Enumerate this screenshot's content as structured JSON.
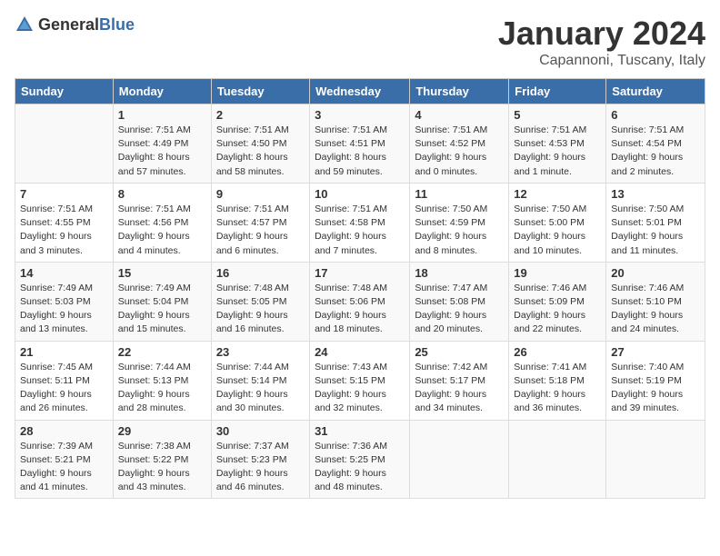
{
  "header": {
    "logo_general": "General",
    "logo_blue": "Blue",
    "month_title": "January 2024",
    "location": "Capannoni, Tuscany, Italy"
  },
  "weekdays": [
    "Sunday",
    "Monday",
    "Tuesday",
    "Wednesday",
    "Thursday",
    "Friday",
    "Saturday"
  ],
  "weeks": [
    [
      {
        "day": "",
        "info": ""
      },
      {
        "day": "1",
        "info": "Sunrise: 7:51 AM\nSunset: 4:49 PM\nDaylight: 8 hours\nand 57 minutes."
      },
      {
        "day": "2",
        "info": "Sunrise: 7:51 AM\nSunset: 4:50 PM\nDaylight: 8 hours\nand 58 minutes."
      },
      {
        "day": "3",
        "info": "Sunrise: 7:51 AM\nSunset: 4:51 PM\nDaylight: 8 hours\nand 59 minutes."
      },
      {
        "day": "4",
        "info": "Sunrise: 7:51 AM\nSunset: 4:52 PM\nDaylight: 9 hours\nand 0 minutes."
      },
      {
        "day": "5",
        "info": "Sunrise: 7:51 AM\nSunset: 4:53 PM\nDaylight: 9 hours\nand 1 minute."
      },
      {
        "day": "6",
        "info": "Sunrise: 7:51 AM\nSunset: 4:54 PM\nDaylight: 9 hours\nand 2 minutes."
      }
    ],
    [
      {
        "day": "7",
        "info": "Sunrise: 7:51 AM\nSunset: 4:55 PM\nDaylight: 9 hours\nand 3 minutes."
      },
      {
        "day": "8",
        "info": "Sunrise: 7:51 AM\nSunset: 4:56 PM\nDaylight: 9 hours\nand 4 minutes."
      },
      {
        "day": "9",
        "info": "Sunrise: 7:51 AM\nSunset: 4:57 PM\nDaylight: 9 hours\nand 6 minutes."
      },
      {
        "day": "10",
        "info": "Sunrise: 7:51 AM\nSunset: 4:58 PM\nDaylight: 9 hours\nand 7 minutes."
      },
      {
        "day": "11",
        "info": "Sunrise: 7:50 AM\nSunset: 4:59 PM\nDaylight: 9 hours\nand 8 minutes."
      },
      {
        "day": "12",
        "info": "Sunrise: 7:50 AM\nSunset: 5:00 PM\nDaylight: 9 hours\nand 10 minutes."
      },
      {
        "day": "13",
        "info": "Sunrise: 7:50 AM\nSunset: 5:01 PM\nDaylight: 9 hours\nand 11 minutes."
      }
    ],
    [
      {
        "day": "14",
        "info": "Sunrise: 7:49 AM\nSunset: 5:03 PM\nDaylight: 9 hours\nand 13 minutes."
      },
      {
        "day": "15",
        "info": "Sunrise: 7:49 AM\nSunset: 5:04 PM\nDaylight: 9 hours\nand 15 minutes."
      },
      {
        "day": "16",
        "info": "Sunrise: 7:48 AM\nSunset: 5:05 PM\nDaylight: 9 hours\nand 16 minutes."
      },
      {
        "day": "17",
        "info": "Sunrise: 7:48 AM\nSunset: 5:06 PM\nDaylight: 9 hours\nand 18 minutes."
      },
      {
        "day": "18",
        "info": "Sunrise: 7:47 AM\nSunset: 5:08 PM\nDaylight: 9 hours\nand 20 minutes."
      },
      {
        "day": "19",
        "info": "Sunrise: 7:46 AM\nSunset: 5:09 PM\nDaylight: 9 hours\nand 22 minutes."
      },
      {
        "day": "20",
        "info": "Sunrise: 7:46 AM\nSunset: 5:10 PM\nDaylight: 9 hours\nand 24 minutes."
      }
    ],
    [
      {
        "day": "21",
        "info": "Sunrise: 7:45 AM\nSunset: 5:11 PM\nDaylight: 9 hours\nand 26 minutes."
      },
      {
        "day": "22",
        "info": "Sunrise: 7:44 AM\nSunset: 5:13 PM\nDaylight: 9 hours\nand 28 minutes."
      },
      {
        "day": "23",
        "info": "Sunrise: 7:44 AM\nSunset: 5:14 PM\nDaylight: 9 hours\nand 30 minutes."
      },
      {
        "day": "24",
        "info": "Sunrise: 7:43 AM\nSunset: 5:15 PM\nDaylight: 9 hours\nand 32 minutes."
      },
      {
        "day": "25",
        "info": "Sunrise: 7:42 AM\nSunset: 5:17 PM\nDaylight: 9 hours\nand 34 minutes."
      },
      {
        "day": "26",
        "info": "Sunrise: 7:41 AM\nSunset: 5:18 PM\nDaylight: 9 hours\nand 36 minutes."
      },
      {
        "day": "27",
        "info": "Sunrise: 7:40 AM\nSunset: 5:19 PM\nDaylight: 9 hours\nand 39 minutes."
      }
    ],
    [
      {
        "day": "28",
        "info": "Sunrise: 7:39 AM\nSunset: 5:21 PM\nDaylight: 9 hours\nand 41 minutes."
      },
      {
        "day": "29",
        "info": "Sunrise: 7:38 AM\nSunset: 5:22 PM\nDaylight: 9 hours\nand 43 minutes."
      },
      {
        "day": "30",
        "info": "Sunrise: 7:37 AM\nSunset: 5:23 PM\nDaylight: 9 hours\nand 46 minutes."
      },
      {
        "day": "31",
        "info": "Sunrise: 7:36 AM\nSunset: 5:25 PM\nDaylight: 9 hours\nand 48 minutes."
      },
      {
        "day": "",
        "info": ""
      },
      {
        "day": "",
        "info": ""
      },
      {
        "day": "",
        "info": ""
      }
    ]
  ]
}
